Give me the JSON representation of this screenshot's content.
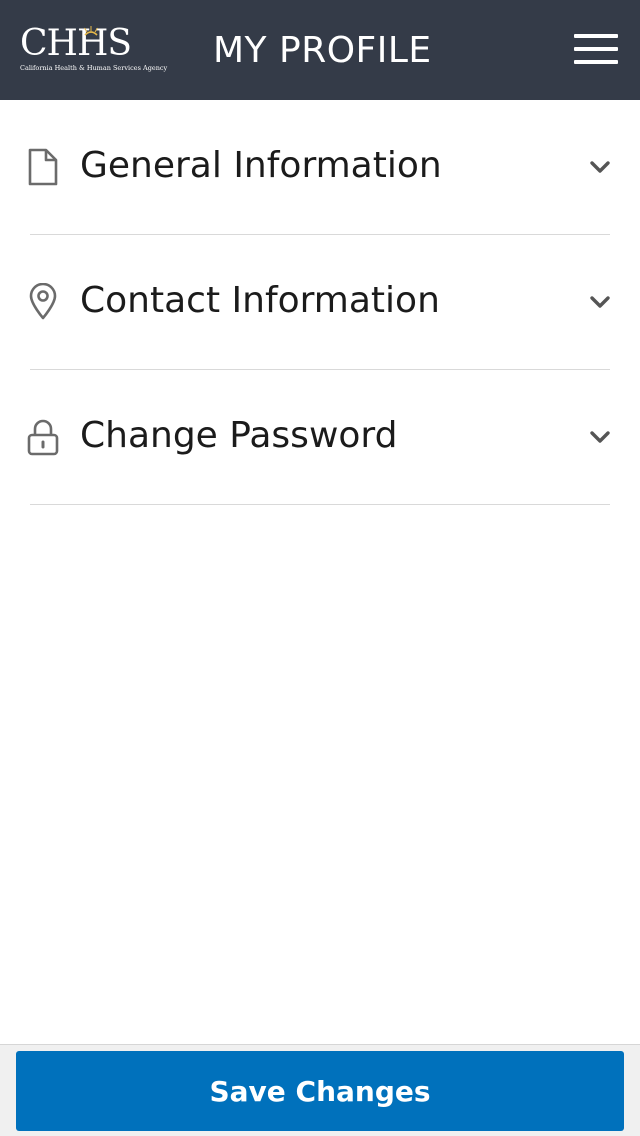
{
  "header": {
    "logo_text": "CHHS",
    "logo_tagline": "California Health & Human Services Agency",
    "title": "MY PROFILE",
    "menu_icon": "hamburger-icon"
  },
  "sections": [
    {
      "label": "General Information",
      "icon": "document-icon",
      "expanded": false
    },
    {
      "label": "Contact Information",
      "icon": "map-pin-icon",
      "expanded": false
    },
    {
      "label": "Change Password",
      "icon": "lock-icon",
      "expanded": false
    }
  ],
  "footer": {
    "save_label": "Save Changes"
  },
  "colors": {
    "header_bg": "#343b48",
    "primary": "#0071bc",
    "icon_gray": "#6b6b6b",
    "divider": "#d9d9d9"
  }
}
